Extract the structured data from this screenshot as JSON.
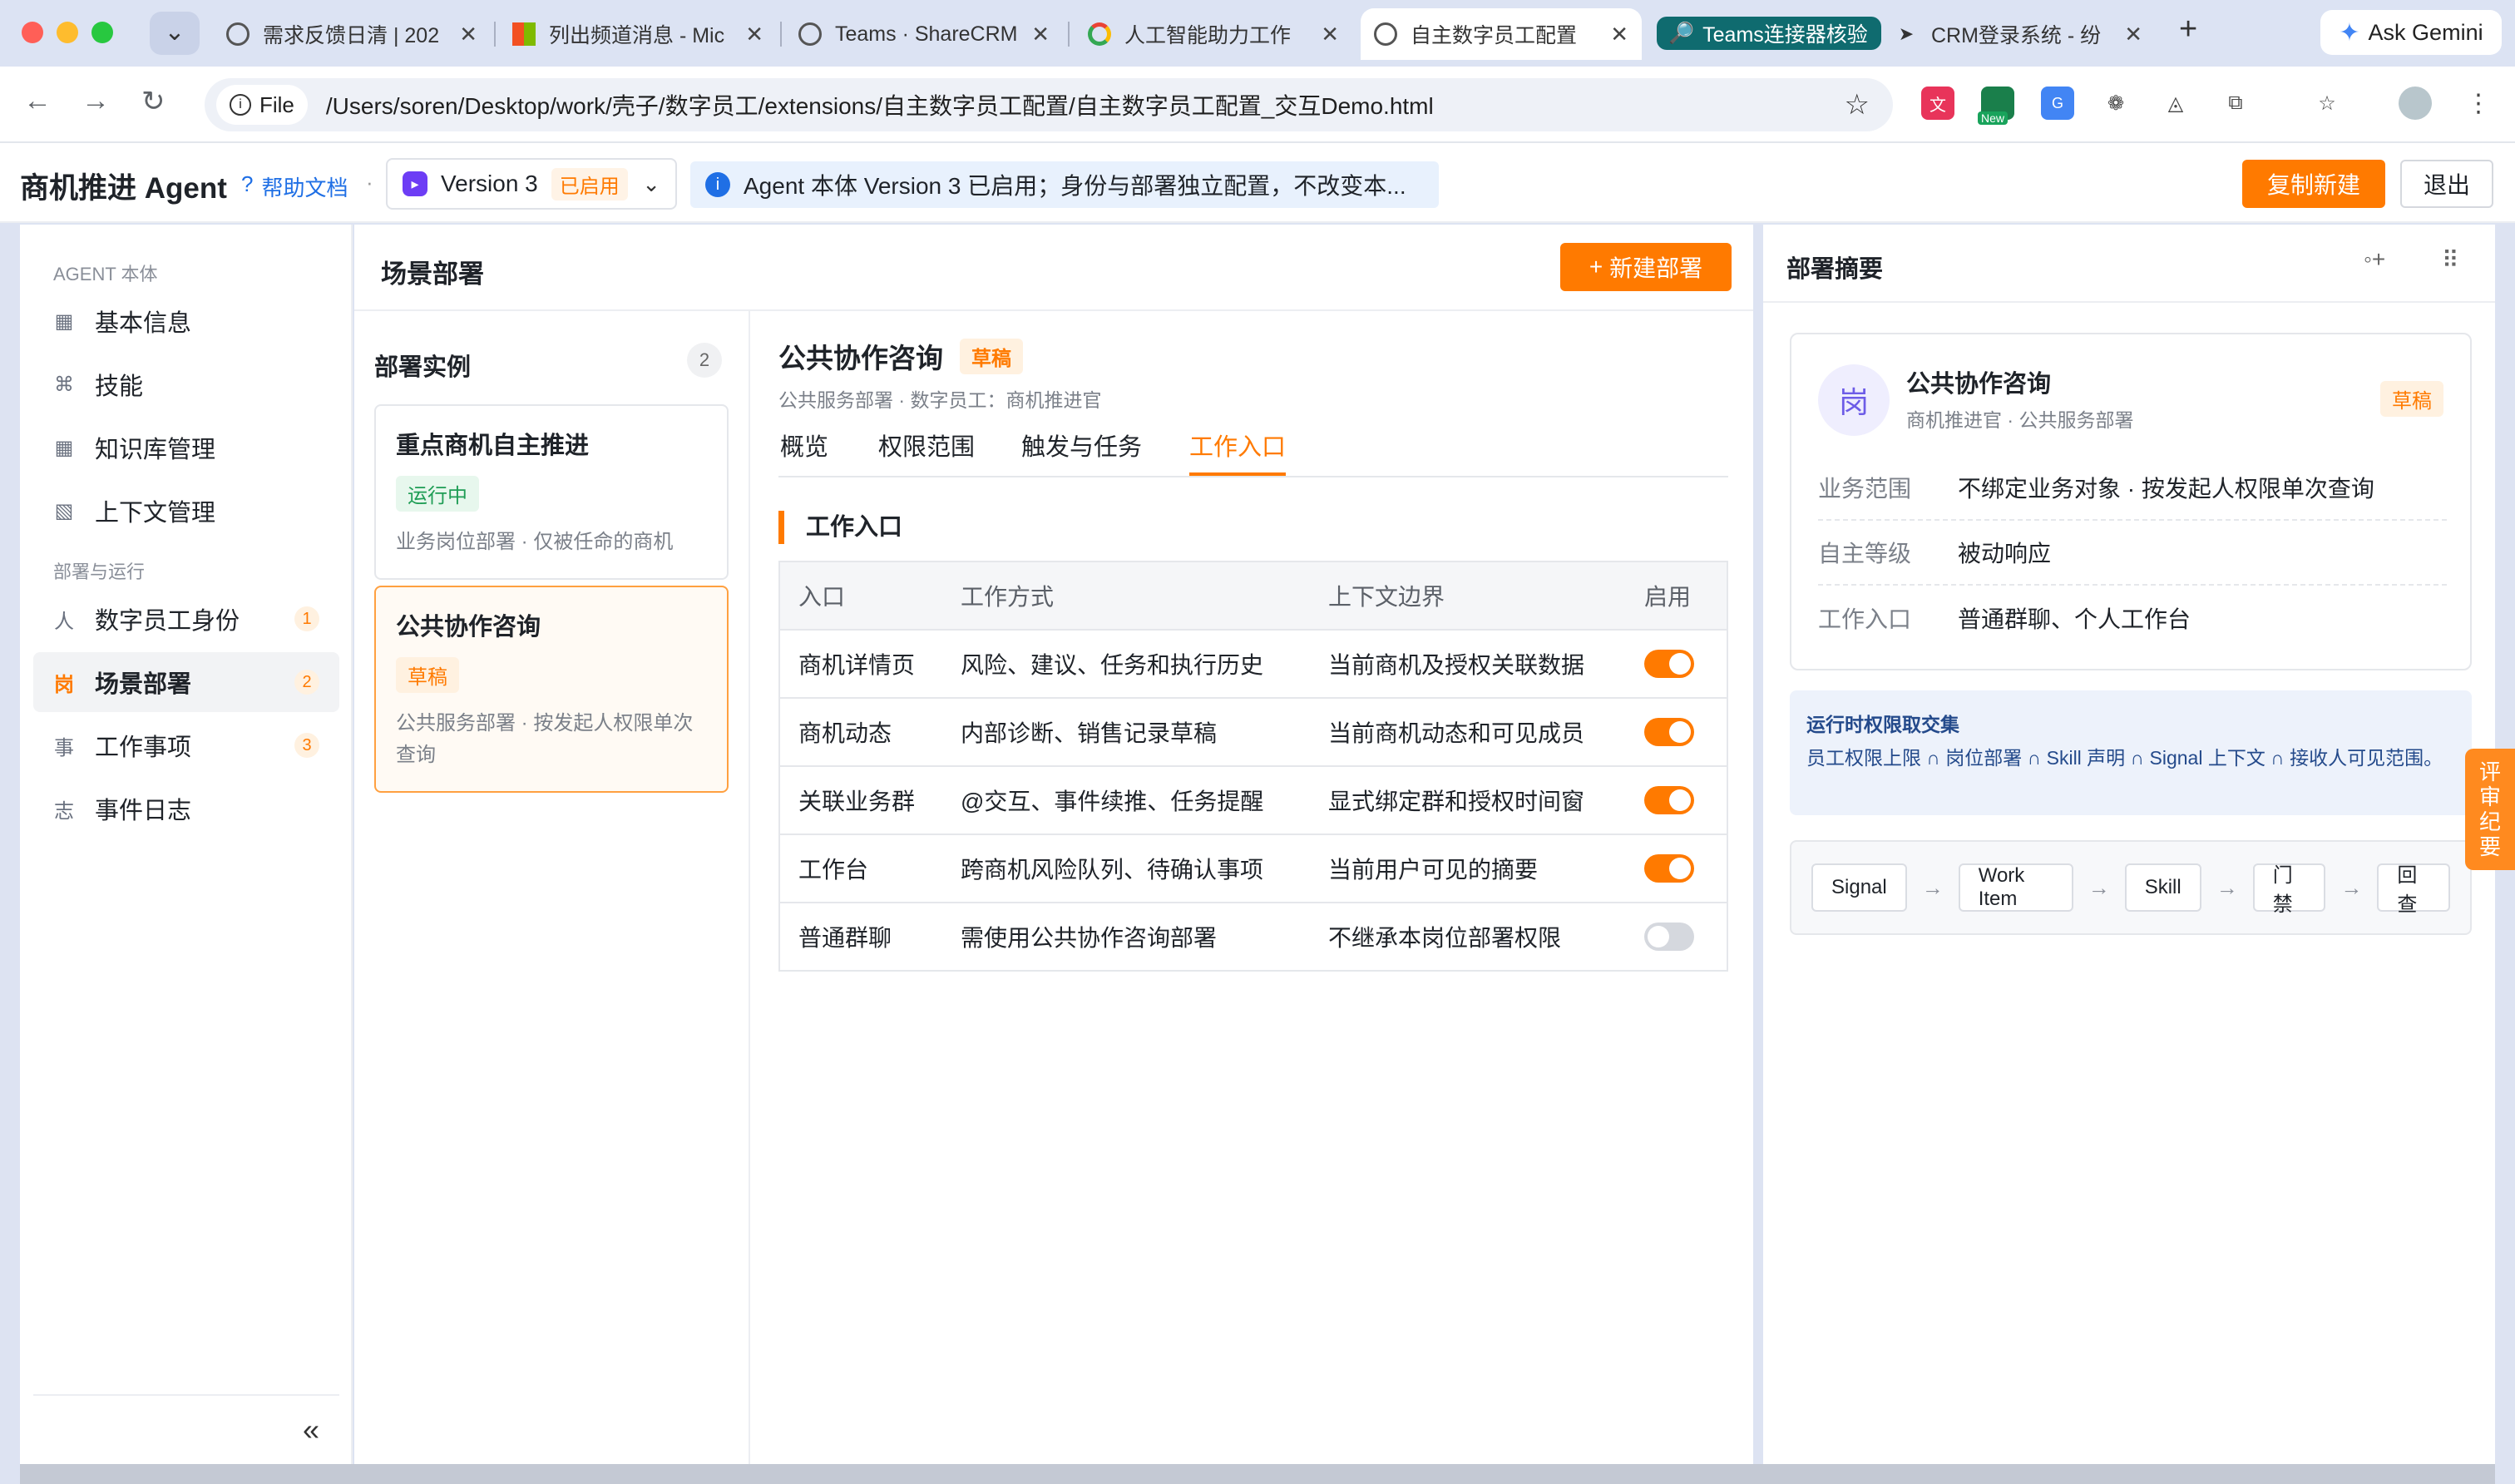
{
  "browser": {
    "tabs": [
      {
        "label": "需求反馈日清 | 202",
        "active": false
      },
      {
        "label": "列出频道消息 - Mic",
        "active": false
      },
      {
        "label": "Teams · ShareCRM",
        "active": false
      },
      {
        "label": "人工智能助力工作",
        "active": false
      },
      {
        "label": "自主数字员工配置",
        "active": true
      },
      {
        "label": "Teams连接器核验",
        "active": false
      },
      {
        "label": "CRM登录系统 - 纷",
        "active": false
      }
    ],
    "new_tab": "+",
    "gemini_label": "Ask Gemini",
    "file_chip": "File",
    "url": "/Users/soren/Desktop/work/壳子/数字员工/extensions/自主数字员工配置/自主数字员工配置_交互Demo.html",
    "ext_new_badge": "New"
  },
  "header": {
    "title": "商机推进 Agent",
    "help_icon": "?",
    "help_label": "帮助文档",
    "dot": "·",
    "version_label": "Version 3",
    "version_status": "已启用",
    "info_text": "Agent 本体 Version 3 已启用；身份与部署独立配置，不改变本...",
    "copy_button": "复制新建",
    "exit_button": "退出"
  },
  "sidebar": {
    "group1": "AGENT 本体",
    "group2": "部署与运行",
    "items": [
      {
        "icon": "▦",
        "label": "基本信息",
        "badge": ""
      },
      {
        "icon": "⌘",
        "label": "技能",
        "badge": ""
      },
      {
        "icon": "▦",
        "label": "知识库管理",
        "badge": ""
      },
      {
        "icon": "▧",
        "label": "上下文管理",
        "badge": ""
      },
      {
        "icon": "人",
        "label": "数字员工身份",
        "badge": "1"
      },
      {
        "icon": "岗",
        "label": "场景部署",
        "badge": "2"
      },
      {
        "icon": "事",
        "label": "工作事项",
        "badge": "3"
      },
      {
        "icon": "志",
        "label": "事件日志",
        "badge": ""
      }
    ],
    "collapse": "«"
  },
  "center": {
    "title": "场景部署",
    "new_button": "新建部署",
    "new_plus": "+",
    "instances_title": "部署实例",
    "instances_count": "2",
    "cards": [
      {
        "title": "重点商机自主推进",
        "status": "运行中",
        "desc": "业务岗位部署 · 仅被任命的商机"
      },
      {
        "title": "公共协作咨询",
        "status": "草稿",
        "desc": "公共服务部署 · 按发起人权限单次查询"
      }
    ]
  },
  "detail": {
    "title": "公共协作咨询",
    "status": "草稿",
    "subtitle": "公共服务部署 · 数字员工：商机推进官",
    "tabs": [
      "概览",
      "权限范围",
      "触发与任务",
      "工作入口"
    ],
    "section_title": "工作入口",
    "table": {
      "headers": [
        "入口",
        "工作方式",
        "上下文边界",
        "启用"
      ],
      "rows": [
        {
          "entry": "商机详情页",
          "mode": "风险、建议、任务和执行历史",
          "boundary": "当前商机及授权关联数据",
          "enabled": true
        },
        {
          "entry": "商机动态",
          "mode": "内部诊断、销售记录草稿",
          "boundary": "当前商机动态和可见成员",
          "enabled": true
        },
        {
          "entry": "关联业务群",
          "mode": "@交互、事件续推、任务提醒",
          "boundary": "显式绑定群和授权时间窗",
          "enabled": true
        },
        {
          "entry": "工作台",
          "mode": "跨商机风险队列、待确认事项",
          "boundary": "当前用户可见的摘要",
          "enabled": true
        },
        {
          "entry": "普通群聊",
          "mode": "需使用公共协作咨询部署",
          "boundary": "不继承本岗位部署权限",
          "enabled": false
        }
      ]
    }
  },
  "summary": {
    "title": "部署摘要",
    "avatar_text": "岗",
    "name": "公共协作咨询",
    "sub": "商机推进官 · 公共服务部署",
    "status": "草稿",
    "rows": [
      {
        "key": "业务范围",
        "value": "不绑定业务对象 · 按发起人权限单次查询"
      },
      {
        "key": "自主等级",
        "value": "被动响应"
      },
      {
        "key": "工作入口",
        "value": "普通群聊、个人工作台"
      }
    ],
    "perm_title": "运行时权限取交集",
    "perm_text": "员工权限上限 ∩ 岗位部署 ∩ Skill 声明 ∩ Signal 上下文 ∩ 接收人可见范围。",
    "flow": [
      "Signal",
      "Work Item",
      "Skill",
      "门禁",
      "回查"
    ],
    "flow_arrow": "→"
  },
  "float_tab": "评审纪要",
  "colors": {
    "accent": "#ff7a00",
    "link": "#1f6fe5",
    "success": "#1f9d55"
  }
}
